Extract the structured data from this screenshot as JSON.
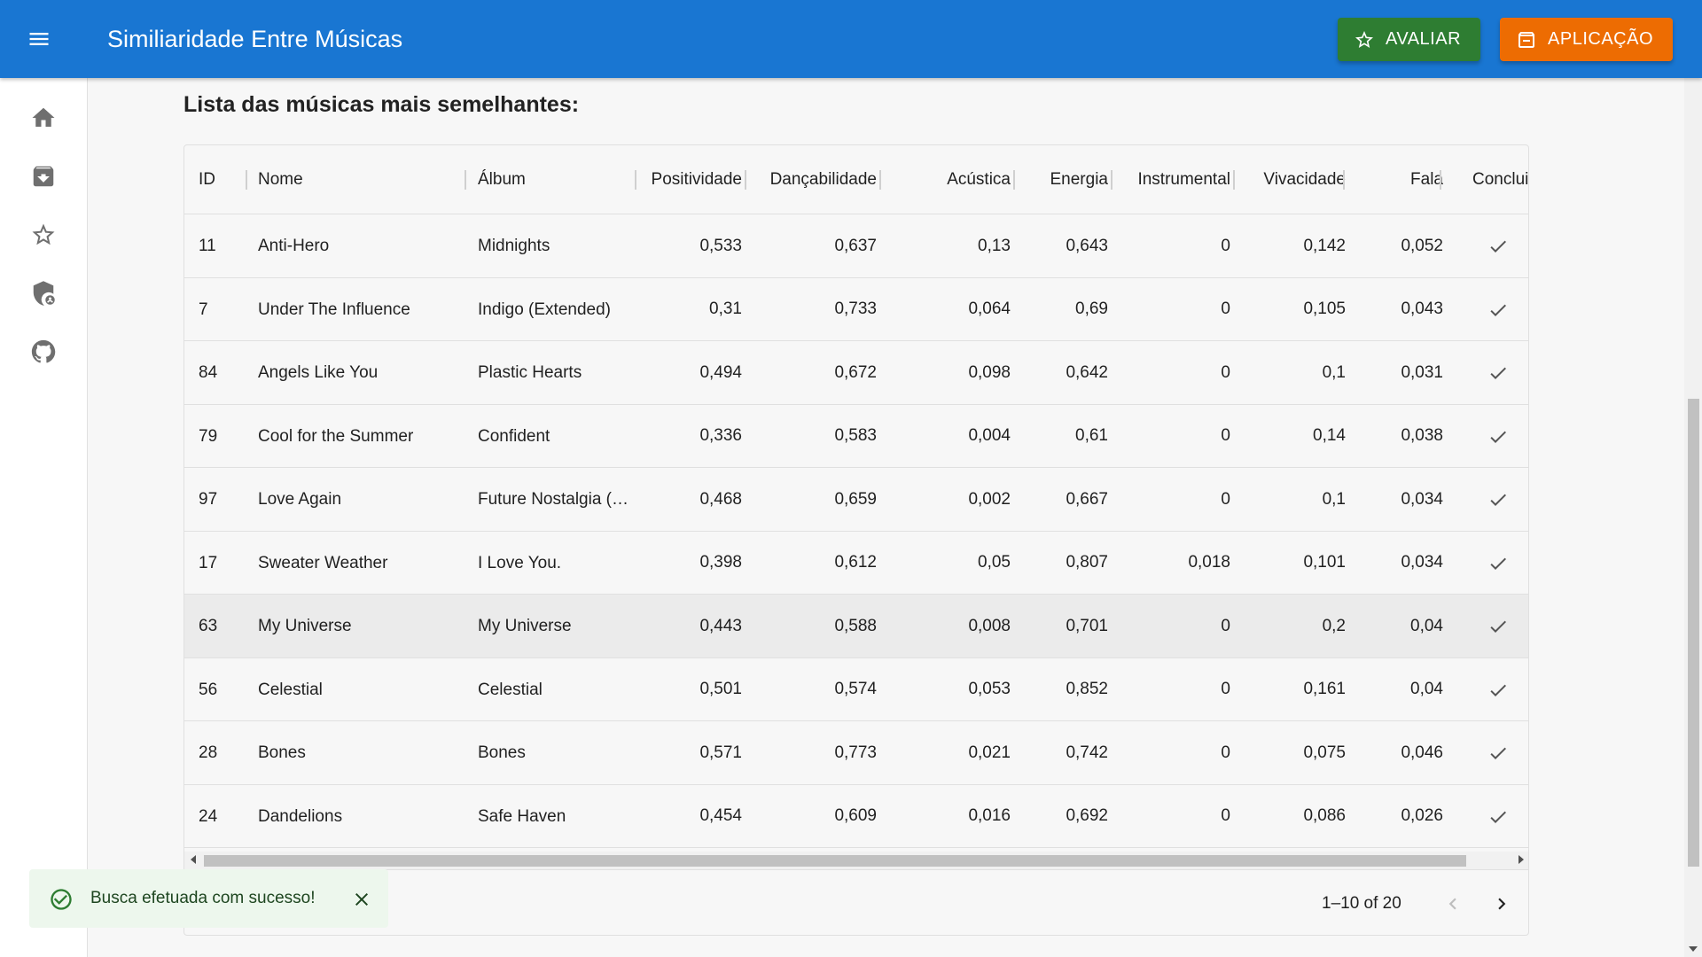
{
  "app": {
    "title": "Similiaridade Entre Músicas",
    "avaliar_label": "AVALIAR",
    "aplicacao_label": "APLICAÇÃO"
  },
  "sidebar": {
    "items": [
      {
        "icon": "home-icon"
      },
      {
        "icon": "archive-icon"
      },
      {
        "icon": "star-icon"
      },
      {
        "icon": "security-icon"
      },
      {
        "icon": "github-icon"
      }
    ]
  },
  "heading": "Lista das músicas mais semelhantes:",
  "table": {
    "columns": [
      "ID",
      "Nome",
      "Álbum",
      "Positividade",
      "Dançabilidade",
      "Acústica",
      "Energia",
      "Instrumental",
      "Vivacidade",
      "Fala",
      "Conclui"
    ],
    "rows": [
      [
        "11",
        "Anti-Hero",
        "Midnights",
        "0,533",
        "0,637",
        "0,13",
        "0,643",
        "0",
        "0,142",
        "0,052"
      ],
      [
        "7",
        "Under The Influence",
        "Indigo (Extended)",
        "0,31",
        "0,733",
        "0,064",
        "0,69",
        "0",
        "0,105",
        "0,043"
      ],
      [
        "84",
        "Angels Like You",
        "Plastic Hearts",
        "0,494",
        "0,672",
        "0,098",
        "0,642",
        "0",
        "0,1",
        "0,031"
      ],
      [
        "79",
        "Cool for the Summer",
        "Confident",
        "0,336",
        "0,583",
        "0,004",
        "0,61",
        "0",
        "0,14",
        "0,038"
      ],
      [
        "97",
        "Love Again",
        "Future Nostalgia (The Moonlight Edition)",
        "0,468",
        "0,659",
        "0,002",
        "0,667",
        "0",
        "0,1",
        "0,034"
      ],
      [
        "17",
        "Sweater Weather",
        "I Love You.",
        "0,398",
        "0,612",
        "0,05",
        "0,807",
        "0,018",
        "0,101",
        "0,034"
      ],
      [
        "63",
        "My Universe",
        "My Universe",
        "0,443",
        "0,588",
        "0,008",
        "0,701",
        "0",
        "0,2",
        "0,04"
      ],
      [
        "56",
        "Celestial",
        "Celestial",
        "0,501",
        "0,574",
        "0,053",
        "0,852",
        "0",
        "0,161",
        "0,04"
      ],
      [
        "28",
        "Bones",
        "Bones",
        "0,571",
        "0,773",
        "0,021",
        "0,742",
        "0",
        "0,075",
        "0,046"
      ],
      [
        "24",
        "Dandelions",
        "Safe Haven",
        "0,454",
        "0,609",
        "0,016",
        "0,692",
        "0",
        "0,086",
        "0,026"
      ]
    ],
    "highlighted_row": 6,
    "pagination": "1–10 of 20"
  },
  "snackbar": {
    "message": "Busca efetuada com sucesso!"
  },
  "colors": {
    "appbar": "#1976d2",
    "avaliar": "#2e7d32",
    "aplicacao": "#ed6c02",
    "snackbar_bg": "#edf7ed",
    "success": "#2e7d32"
  }
}
